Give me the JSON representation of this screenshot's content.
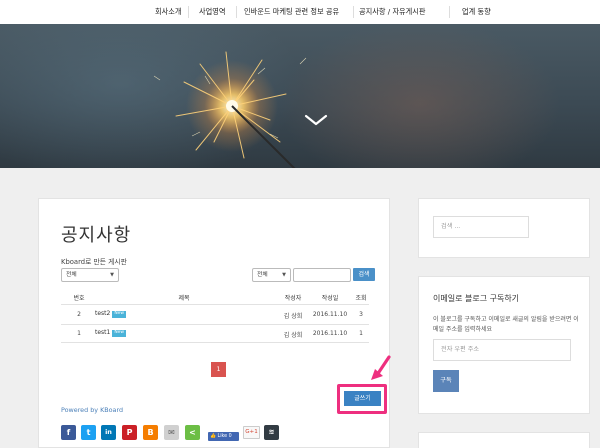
{
  "nav": {
    "items": [
      {
        "label": "회사소개"
      },
      {
        "label": "사업영역"
      },
      {
        "label": "인바운드 마케팅 관련 정보 공유"
      },
      {
        "label": "공지사항 / 자유게시판"
      },
      {
        "label": "업계 동향"
      }
    ]
  },
  "board": {
    "title": "공지사항",
    "subtitle": "Kboard로 만든 게시판",
    "category_filter": "전체",
    "search_field_select": "전체",
    "search_query": "",
    "search_button": "검색",
    "columns": [
      "번호",
      "제목",
      "작성자",
      "작성일",
      "조회"
    ],
    "rows": [
      {
        "no": "2",
        "title": "test2",
        "badge": "New",
        "author": "김 상희",
        "date": "2016.11.10",
        "views": "3"
      },
      {
        "no": "1",
        "title": "test1",
        "badge": "New",
        "author": "김 상희",
        "date": "2016.11.10",
        "views": "1"
      }
    ],
    "current_page": "1",
    "write_button": "글쓰기",
    "powered_by": "Powered by KBoard"
  },
  "share": {
    "icons": [
      "facebook-icon",
      "twitter-icon",
      "linkedin-icon",
      "pinterest-icon",
      "blogger-icon",
      "email-icon",
      "share-icon",
      "buffer-icon"
    ],
    "like_label": "Like 0",
    "gplus_label": "G+1"
  },
  "sidebar": {
    "search_placeholder": "검색 ...",
    "subscribe_title": "이메일로 블로그 구독하기",
    "subscribe_desc": "이 블로그를 구독하고 이메일로 새글의 알림을 받으려면 이메일 주소를 입력하세요",
    "email_placeholder": "전자 우편 주소",
    "subscribe_button": "구독"
  },
  "colors": {
    "accent_pink": "#ee2f7f",
    "button_blue": "#3a82c3",
    "page_red": "#d9534f",
    "new_badge": "#4ab3d9"
  }
}
